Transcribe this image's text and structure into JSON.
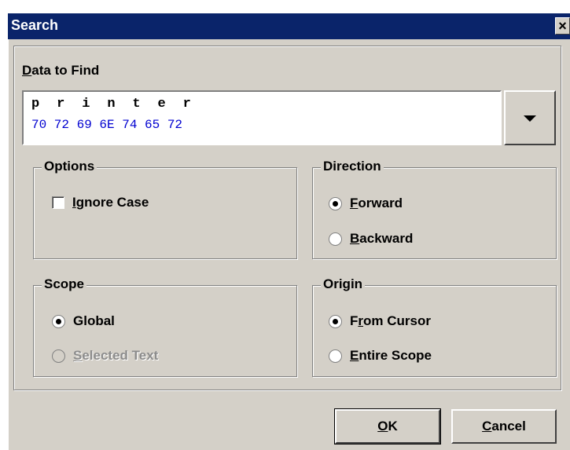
{
  "window": {
    "title": "Search",
    "close_glyph": "×"
  },
  "find": {
    "label_mnemonic": "D",
    "label_rest": "ata to Find",
    "chars": "p  r  i  n  t  e  r",
    "hex": "70 72 69 6E 74 65 72",
    "hex_color": "#0000d0"
  },
  "options": {
    "title": "Options",
    "ignore_case": {
      "mnemonic": "I",
      "rest": "gnore Case",
      "checked": false
    }
  },
  "direction": {
    "title": "Direction",
    "forward": {
      "mnemonic": "F",
      "rest": "orward",
      "selected": true
    },
    "backward": {
      "mnemonic": "B",
      "rest": "ackward",
      "selected": false
    }
  },
  "scope": {
    "title": "Scope",
    "global": {
      "label": "Global",
      "selected": true
    },
    "selected_text": {
      "mnemonic": "S",
      "rest": "elected Text",
      "selected": false,
      "enabled": false
    }
  },
  "origin": {
    "title": "Origin",
    "from_cursor": {
      "pre": "F",
      "mnemonic": "r",
      "rest": "om Cursor",
      "selected": true
    },
    "entire_scope": {
      "mnemonic": "E",
      "rest": "ntire Scope",
      "selected": false
    }
  },
  "buttons": {
    "ok": {
      "mnemonic": "O",
      "rest": "K"
    },
    "cancel": {
      "mnemonic": "C",
      "rest": "ancel"
    }
  },
  "colors": {
    "title_bar": "#0a246a",
    "face": "#d4d0c8",
    "disabled_text": "#8c8c8c"
  }
}
